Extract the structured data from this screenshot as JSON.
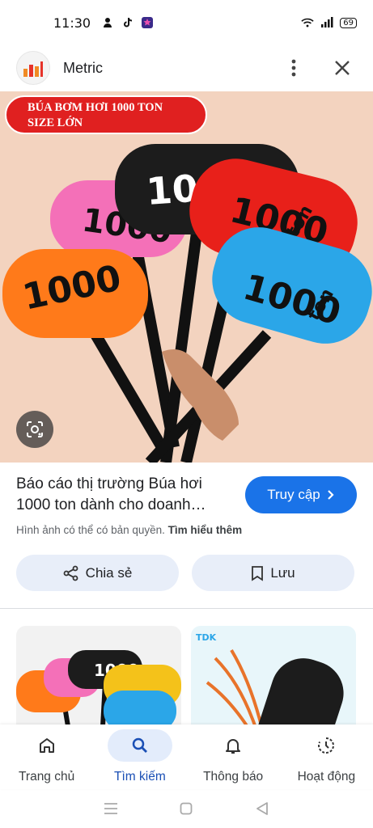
{
  "status_bar": {
    "time": "11:30",
    "battery": "69"
  },
  "app_bar": {
    "site_name": "Metric"
  },
  "image": {
    "banner_line1": "BÚA BƠM HƠI 1000 TON",
    "banner_line2": "SIZE LỚN",
    "hammer_text": "1000",
    "hammer_unit": "ton"
  },
  "result": {
    "title": "Báo cáo thị trường Búa hơi 1000 ton dành cho doanh…",
    "visit_label": "Truy cập",
    "copyright_text": "Hình ảnh có thể có bản quyền.",
    "learn_more": "Tìm hiểu thêm"
  },
  "actions": {
    "share_label": "Chia sẻ",
    "save_label": "Lưu"
  },
  "related": {
    "thumb2_logo": "TDK"
  },
  "bottom_nav": [
    {
      "label": "Trang chủ"
    },
    {
      "label": "Tìm kiếm"
    },
    {
      "label": "Thông báo"
    },
    {
      "label": "Hoạt động"
    }
  ],
  "colors": {
    "accent": "#1a73e8",
    "pill": "#e8eef9",
    "active_nav": "#e3ecfb",
    "banner": "#e02020"
  }
}
